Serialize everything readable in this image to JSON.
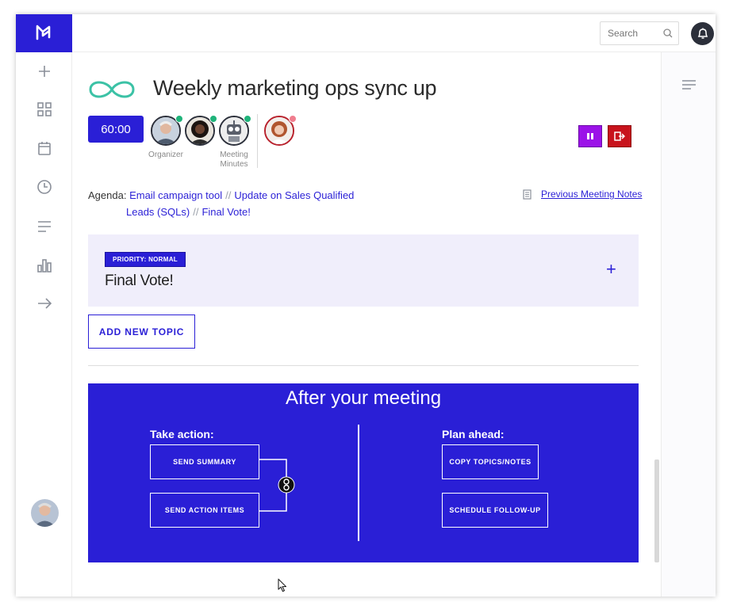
{
  "app": {
    "accent": "#2a1fd6"
  },
  "topbar": {
    "search_placeholder": "Search"
  },
  "sidebar": {
    "items": [
      {
        "icon": "plus-icon"
      },
      {
        "icon": "grid-icon"
      },
      {
        "icon": "calendar-icon"
      },
      {
        "icon": "clock-icon"
      },
      {
        "icon": "list-icon"
      },
      {
        "icon": "chart-icon"
      },
      {
        "icon": "arrow-right-icon"
      }
    ]
  },
  "meeting": {
    "title": "Weekly marketing ops sync up",
    "timer": "60:00",
    "participants": [
      {
        "label": "Organizer",
        "status_color": "#1fb37a"
      },
      {
        "label": "",
        "status_color": "#1fb37a"
      },
      {
        "label": "Meeting Minutes",
        "status_color": "#1fb37a"
      },
      {
        "label": "",
        "status_color": "#f07d8e"
      }
    ]
  },
  "agenda": {
    "label": "Agenda:",
    "items": [
      "Email campaign tool",
      "Update on Sales Qualified Leads (SQLs)",
      "Final Vote!"
    ],
    "item2_part1": "Update on Sales Qualified",
    "item2_part2": "Leads (SQLs)",
    "separator": "//",
    "previous_notes": "Previous Meeting Notes"
  },
  "topic": {
    "priority": "PRIORITY: NORMAL",
    "title": "Final Vote!"
  },
  "add_topic_label": "ADD NEW TOPIC",
  "after_meeting": {
    "title": "After your meeting",
    "take_action": {
      "heading": "Take action:",
      "buttons": [
        "SEND SUMMARY",
        "SEND ACTION ITEMS"
      ]
    },
    "plan_ahead": {
      "heading": "Plan ahead:",
      "buttons": [
        "COPY TOPICS/NOTES",
        "SCHEDULE FOLLOW-UP"
      ]
    }
  }
}
